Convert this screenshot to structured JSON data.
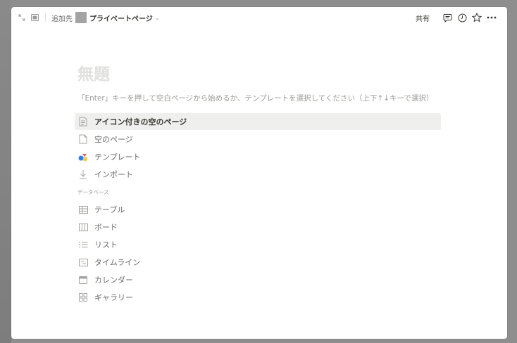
{
  "topbar": {
    "add_to": "追加先",
    "page_name": "プライベートページ",
    "share": "共有",
    "icons": [
      "expand-icon",
      "sidebar-toggle-icon",
      "comment-icon",
      "clock-icon",
      "star-icon",
      "more-icon"
    ]
  },
  "page": {
    "title": "無題",
    "hint": "「Enter」キーを押して空白ページから始めるか、テンプレートを選択してください（上下↑↓キーで選択）"
  },
  "options": [
    {
      "label": "アイコン付きの空のページ",
      "icon": "page-icon-icon"
    },
    {
      "label": "空のページ",
      "icon": "blank-page-icon"
    },
    {
      "label": "テンプレート",
      "icon": "templates-icon"
    },
    {
      "label": "インポート",
      "icon": "import-icon"
    }
  ],
  "database_section": {
    "label": "データベース",
    "items": [
      {
        "label": "テーブル",
        "icon": "table-icon"
      },
      {
        "label": "ボード",
        "icon": "board-icon"
      },
      {
        "label": "リスト",
        "icon": "list-icon"
      },
      {
        "label": "タイムライン",
        "icon": "timeline-icon"
      },
      {
        "label": "カレンダー",
        "icon": "calendar-icon"
      },
      {
        "label": "ギャラリー",
        "icon": "gallery-icon"
      }
    ]
  },
  "colors": {
    "accent_bg": "#efefee",
    "text": "#37352f",
    "muted": "#9b9a97"
  }
}
